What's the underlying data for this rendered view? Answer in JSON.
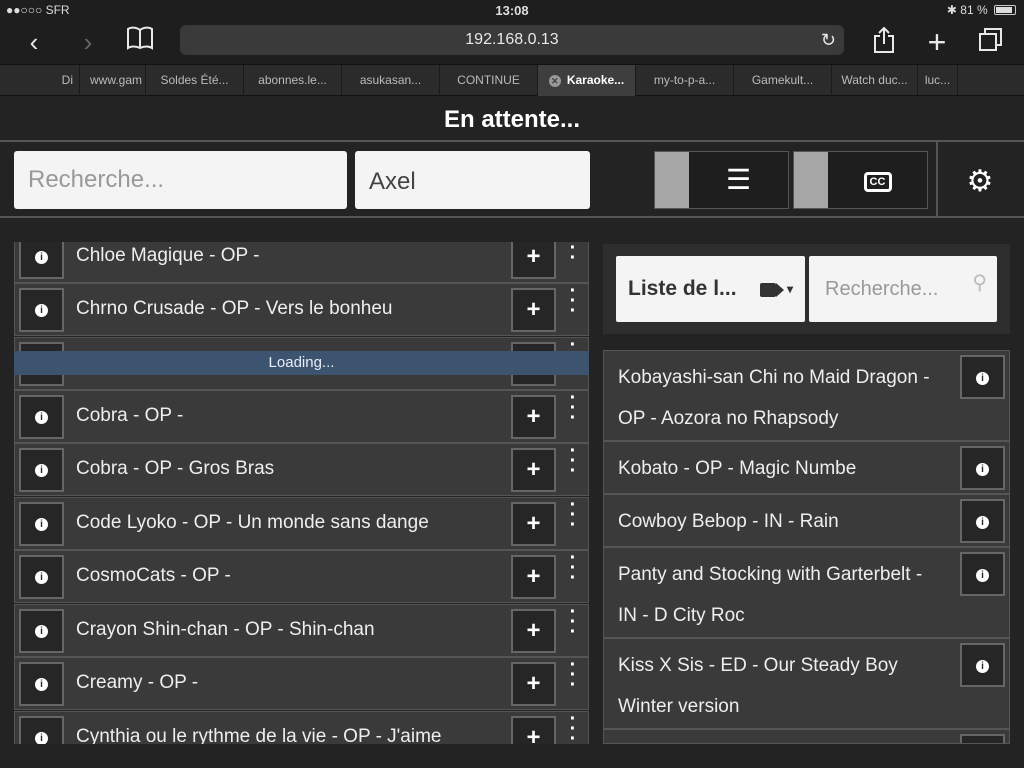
{
  "statusbar": {
    "carrier": "●●○○○ SFR",
    "time": "13:08",
    "battery": "81 %"
  },
  "browser": {
    "url": "192.168.0.13",
    "tabs": [
      {
        "label": "Di"
      },
      {
        "label": "www.gam"
      },
      {
        "label": "Soldes Été..."
      },
      {
        "label": "abonnes.le..."
      },
      {
        "label": "asukasan..."
      },
      {
        "label": "CONTINUE"
      },
      {
        "label": "Karaoke..."
      },
      {
        "label": "my-to-p-a..."
      },
      {
        "label": "Gamekult..."
      },
      {
        "label": "Watch duc..."
      },
      {
        "label": "luc..."
      }
    ]
  },
  "header": {
    "title": "En attente..."
  },
  "controls": {
    "search_placeholder": "Recherche...",
    "username": "Axel"
  },
  "library": {
    "loading": "Loading...",
    "items": [
      {
        "title": "Chloe Magique - OP -"
      },
      {
        "title": "Chrno Crusade - OP - Vers le bonheu"
      },
      {
        "title": ""
      },
      {
        "title": "Cobra - OP -"
      },
      {
        "title": "Cobra - OP - Gros Bras"
      },
      {
        "title": "Code Lyoko - OP - Un monde sans dange"
      },
      {
        "title": "CosmoCats - OP -"
      },
      {
        "title": "Crayon Shin-chan - OP - Shin-chan"
      },
      {
        "title": "Creamy - OP -"
      },
      {
        "title": "Cynthia ou le rythme de la vie - OP - J'aime"
      }
    ]
  },
  "playlist_panel": {
    "dropdown_label": "Liste de l...",
    "search_placeholder": "Recherche...",
    "items": [
      {
        "line1": "Kobayashi-san Chi no Maid Dragon -",
        "line2": "OP - Aozora no Rhapsody"
      },
      {
        "line1": "Kobato - OP - Magic Numbe",
        "line2": ""
      },
      {
        "line1": "Cowboy Bebop - IN - Rain",
        "line2": ""
      },
      {
        "line1": "Panty and Stocking with Garterbelt -",
        "line2": "IN - D City Roc"
      },
      {
        "line1": "Kiss X Sis - ED - Our Steady Boy",
        "line2": "Winter version"
      },
      {
        "line1": "",
        "line2": ""
      }
    ]
  }
}
